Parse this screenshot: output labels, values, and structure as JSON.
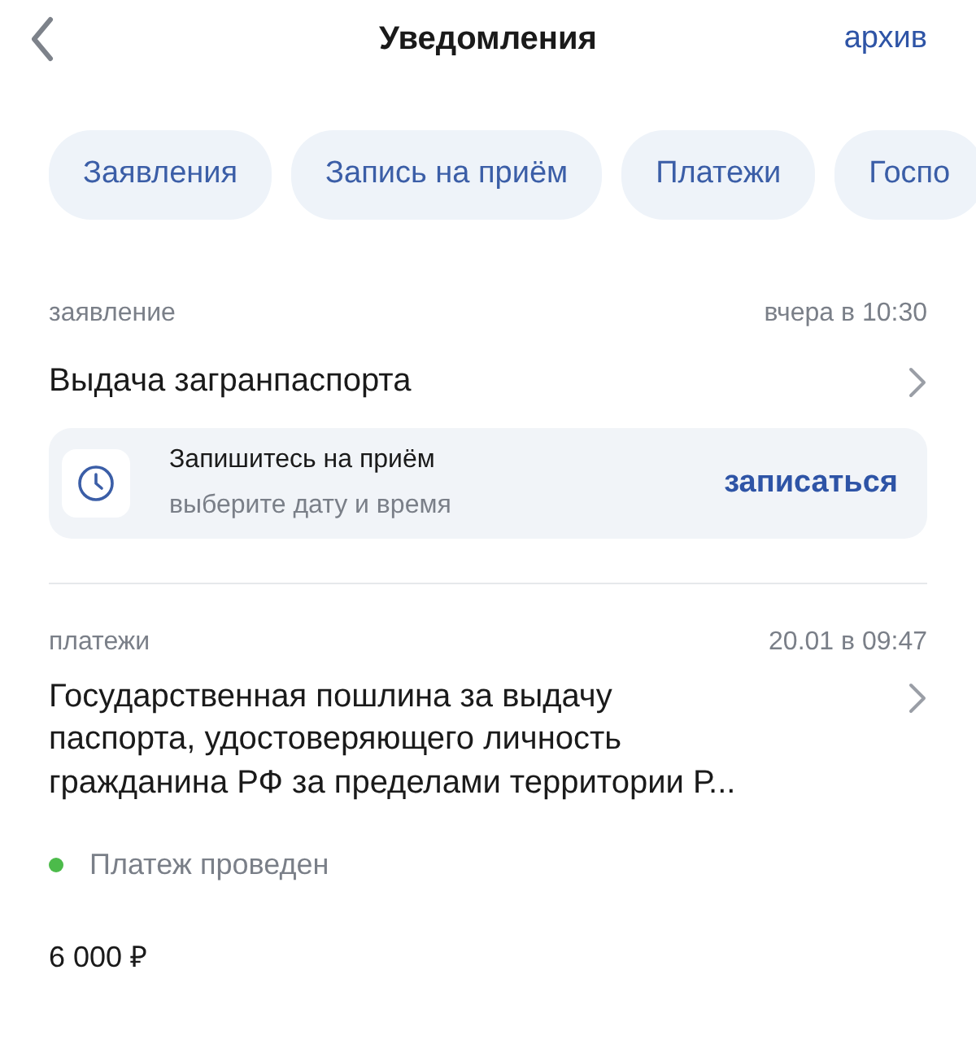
{
  "header": {
    "title": "Уведомления",
    "action": "архив"
  },
  "filters": [
    {
      "label": "Заявления",
      "selected": false
    },
    {
      "label": "Запись на приём",
      "selected": false
    },
    {
      "label": "Платежи",
      "selected": false
    },
    {
      "label": "Госпо",
      "selected": false
    }
  ],
  "notifications": [
    {
      "category": "заявление",
      "time": "вчера в 10:30",
      "title": "Выдача загранпаспорта",
      "action_card": {
        "title": "Запишитесь на приём",
        "subtitle": "выберите дату и время",
        "button": "записаться"
      }
    },
    {
      "category": "платежи",
      "time": "20.01 в 09:47",
      "title": "Государственная пошлина за выдачу\nпаспорта, удостоверяющего личность\nгражданина РФ за пределами территории Р...",
      "status": {
        "text": "Платеж проведен",
        "color": "#4cbb4a"
      },
      "amount": "6 000 ₽"
    }
  ]
}
